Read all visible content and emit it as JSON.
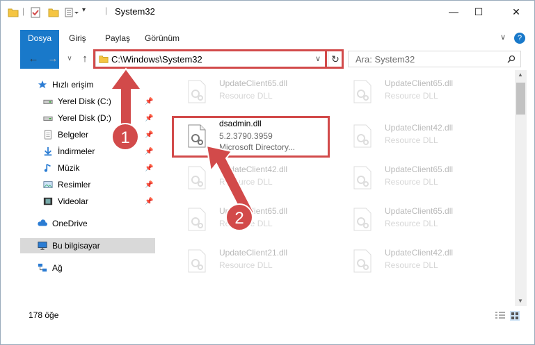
{
  "window": {
    "title": "System32",
    "controls": {
      "minimize": "—",
      "maximize": "☐",
      "close": "✕"
    }
  },
  "ribbon": {
    "tabs": [
      "Dosya",
      "Giriş",
      "Paylaş",
      "Görünüm"
    ],
    "help": "?"
  },
  "nav": {
    "address": "C:\\Windows\\System32",
    "search_placeholder": "Ara: System32"
  },
  "sidebar": {
    "items": [
      {
        "label": "Hızlı erişim",
        "icon": "star-icon"
      },
      {
        "label": "Yerel Disk (C:)",
        "icon": "drive-icon",
        "pinned": true
      },
      {
        "label": "Yerel Disk (D:)",
        "icon": "drive-icon",
        "pinned": true
      },
      {
        "label": "Belgeler",
        "icon": "document-icon",
        "pinned": true
      },
      {
        "label": "İndirmeler",
        "icon": "download-icon",
        "pinned": true
      },
      {
        "label": "Müzik",
        "icon": "music-icon",
        "pinned": true
      },
      {
        "label": "Resimler",
        "icon": "picture-icon",
        "pinned": true
      },
      {
        "label": "Videolar",
        "icon": "video-icon",
        "pinned": true
      },
      {
        "label": "OneDrive",
        "icon": "cloud-icon"
      },
      {
        "label": "Bu bilgisayar",
        "icon": "computer-icon",
        "selected": true
      },
      {
        "label": "Ağ",
        "icon": "network-icon"
      }
    ]
  },
  "files": {
    "highlighted": {
      "name": "dsadmin.dll",
      "version": "5.2.3790.3959",
      "description": "Microsoft Directory..."
    },
    "ghosts": [
      {
        "name": "UpdateClient65.dll",
        "desc": "Resource DLL"
      },
      {
        "name": "UpdateClient65.dll",
        "desc": "Resource DLL"
      },
      {
        "name": "UpdateClient42.dll",
        "desc": "Resource DLL"
      },
      {
        "name": "UpdateClient42.dll",
        "desc": "Resource DLL"
      },
      {
        "name": "UpdateClient65.dll",
        "desc": "Resource DLL"
      },
      {
        "name": "UpdateClient65.dll",
        "desc": "Resource DLL"
      },
      {
        "name": "UpdateClient65.dll",
        "desc": "Resource DLL"
      },
      {
        "name": "UpdateClient21.dll",
        "desc": "Resource DLL"
      },
      {
        "name": "UpdateClient42.dll",
        "desc": "Resource DLL"
      }
    ]
  },
  "status": {
    "count": "178 öğe"
  },
  "annotations": {
    "badge1": "1",
    "badge2": "2"
  },
  "colors": {
    "accent": "#1979ca",
    "annotation": "#d24a4a",
    "selected_bg": "#d9d9d9"
  }
}
